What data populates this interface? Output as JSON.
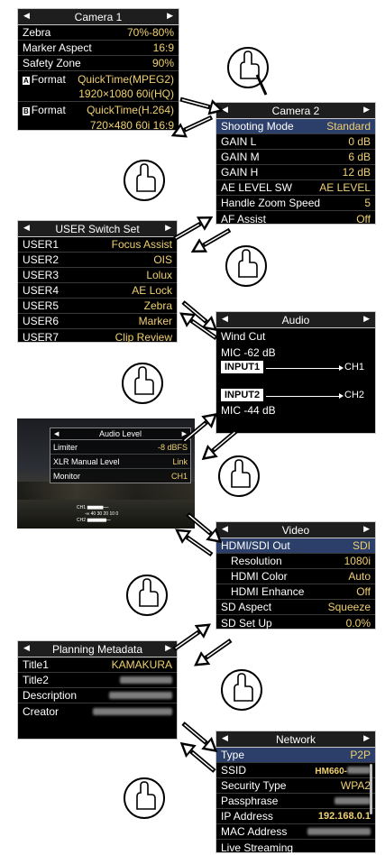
{
  "camera1": {
    "title": "Camera 1",
    "rows": [
      {
        "label": "Zebra",
        "value": "70%-80%"
      },
      {
        "label": "Marker Aspect",
        "value": "16:9"
      },
      {
        "label": "Safety Zone",
        "value": "90%"
      }
    ],
    "formatA": {
      "tag": "A",
      "label": "Format",
      "value": "QuickTime(MPEG2)",
      "sub": "1920×1080  60i(HQ)"
    },
    "formatB": {
      "tag": "B",
      "label": "Format",
      "value": "QuickTime(H.264)",
      "sub": "720×480  60i  16:9"
    }
  },
  "camera2": {
    "title": "Camera 2",
    "rows": [
      {
        "label": "Shooting Mode",
        "value": "Standard"
      },
      {
        "label": "GAIN L",
        "value": "0 dB"
      },
      {
        "label": "GAIN M",
        "value": "6 dB"
      },
      {
        "label": "GAIN H",
        "value": "12 dB"
      },
      {
        "label": "AE LEVEL SW",
        "value": "AE LEVEL"
      },
      {
        "label": "Handle Zoom Speed",
        "value": "5"
      },
      {
        "label": "AF Assist",
        "value": "Off"
      }
    ]
  },
  "userSwitch": {
    "title": "USER Switch Set",
    "rows": [
      {
        "label": "USER1",
        "value": "Focus Assist"
      },
      {
        "label": "USER2",
        "value": "OIS"
      },
      {
        "label": "USER3",
        "value": "Lolux"
      },
      {
        "label": "USER4",
        "value": "AE Lock"
      },
      {
        "label": "USER5",
        "value": "Zebra"
      },
      {
        "label": "USER6",
        "value": "Marker"
      },
      {
        "label": "USER7",
        "value": "Clip Review"
      }
    ]
  },
  "audio": {
    "title": "Audio",
    "wind_cut": "Wind Cut",
    "mic1": "MIC  -62 dB",
    "input1": "INPUT1",
    "ch1": "CH1",
    "input2": "INPUT2",
    "ch2": "CH2",
    "mic2": "MIC  -44 dB"
  },
  "audioLevel": {
    "title": "Audio Level",
    "rows": [
      {
        "label": "Limiter",
        "value": "-8 dBFS"
      },
      {
        "label": "XLR Manual Level",
        "value": "Link"
      },
      {
        "label": "Monitor",
        "value": "CH1"
      }
    ],
    "meter_ch1": "CH1",
    "meter_scale": "-∞ 40  30  20   10   0",
    "meter_ch2": "CH2"
  },
  "video": {
    "title": "Video",
    "rows": [
      {
        "label": "HDMI/SDI Out",
        "value": "SDI"
      },
      {
        "label": "Resolution",
        "value": "1080i"
      },
      {
        "label": "HDMI Color",
        "value": "Auto"
      },
      {
        "label": "HDMI Enhance",
        "value": "Off"
      },
      {
        "label": "SD Aspect",
        "value": "Squeeze"
      },
      {
        "label": "SD Set Up",
        "value": "0.0%"
      }
    ]
  },
  "planning": {
    "title": "Planning Metadata",
    "title1_label": "Title1",
    "title1_value": "KAMAKURA",
    "title2_label": "Title2",
    "description_label": "Description",
    "creator_label": "Creator"
  },
  "network": {
    "title": "Network",
    "type_label": "Type",
    "type_value": "P2P",
    "ssid_label": "SSID",
    "ssid_value": "HM660-",
    "security_label": "Security Type",
    "security_value": "WPA2",
    "pass_label": "Passphrase",
    "ip_label": "IP Address",
    "ip_value": "192.168.0.1",
    "mac_label": "MAC Address",
    "live_label": "Live Streaming"
  },
  "icons": [
    "arrow-left-icon",
    "arrow-right-icon",
    "touch-hand-icon",
    "navigate-arrow-icon"
  ],
  "colors": {
    "value": "#f0d070",
    "selected_row": "#2c3f6a"
  }
}
